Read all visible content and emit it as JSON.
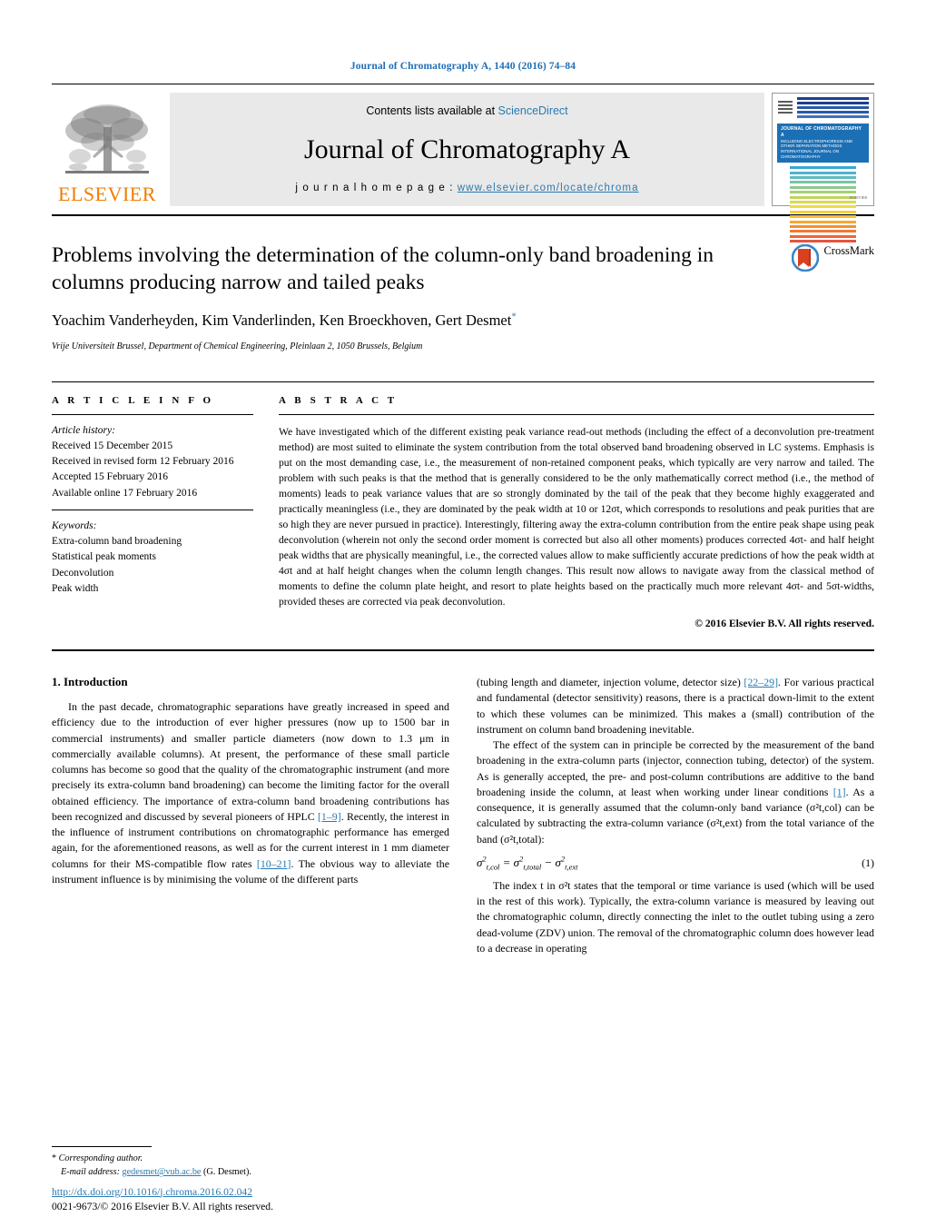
{
  "running_head": "Journal of Chromatography A, 1440 (2016) 74–84",
  "masthead": {
    "publisher_name": "ELSEVIER",
    "contents_prefix": "Contents lists available at ",
    "contents_link": "ScienceDirect",
    "journal_title": "Journal of Chromatography A",
    "homepage_prefix": "j o u r n a l   h o m e p a g e :   ",
    "homepage_url": "www.elsevier.com/locate/chroma",
    "cover": {
      "title": "JOURNAL OF CHROMATOGRAPHY A",
      "subtitle": "INCLUDING ELECTROPHORESIS AND OTHER SEPARATION METHODS INTERNATIONAL JOURNAL ON CHROMATOGRAPHY",
      "footer": "ELSEVIER"
    }
  },
  "article": {
    "title": "Problems involving the determination of the column-only band broadening in columns producing narrow and tailed peaks",
    "authors": "Yoachim Vanderheyden, Kim Vanderlinden, Ken Broeckhoven, Gert Desmet",
    "corresponding_marker": "*",
    "affiliation": "Vrije Universiteit Brussel, Department of Chemical Engineering, Pleinlaan 2, 1050 Brussels, Belgium",
    "crossmark_label": "CrossMark"
  },
  "info": {
    "heading": "A R T I C L E     I N F O",
    "history_label": "Article history:",
    "history": [
      "Received 15 December 2015",
      "Received in revised form 12 February 2016",
      "Accepted 15 February 2016",
      "Available online 17 February 2016"
    ],
    "keywords_label": "Keywords:",
    "keywords": [
      "Extra-column band broadening",
      "Statistical peak moments",
      "Deconvolution",
      "Peak width"
    ]
  },
  "abstract": {
    "heading": "A B S T R A C T",
    "text": "We have investigated which of the different existing peak variance read-out methods (including the effect of a deconvolution pre-treatment method) are most suited to eliminate the system contribution from the total observed band broadening observed in LC systems. Emphasis is put on the most demanding case, i.e., the measurement of non-retained component peaks, which typically are very narrow and tailed. The problem with such peaks is that the method that is generally considered to be the only mathematically correct method (i.e., the method of moments) leads to peak variance values that are so strongly dominated by the tail of the peak that they become highly exaggerated and practically meaningless (i.e., they are dominated by the peak width at 10 or 12σt, which corresponds to resolutions and peak purities that are so high they are never pursued in practice). Interestingly, filtering away the extra-column contribution from the entire peak shape using peak deconvolution (wherein not only the second order moment is corrected but also all other moments) produces corrected 4σt- and half height peak widths that are physically meaningful, i.e., the corrected values allow to make sufficiently accurate predictions of how the peak width at 4σt and at half height changes when the column length changes. This result now allows to navigate away from the classical method of moments to define the column plate height, and resort to plate heights based on the practically much more relevant 4σt- and 5σt-widths, provided theses are corrected via peak deconvolution.",
    "copyright": "© 2016 Elsevier B.V. All rights reserved."
  },
  "body": {
    "section_number": "1.",
    "section_title": "Introduction",
    "left_para_1_a": "In the past decade, chromatographic separations have greatly increased in speed and efficiency due to the introduction of ever higher pressures (now up to 1500 bar in commercial instruments) and smaller particle diameters (now down to 1.3 μm in commercially available columns). At present, the performance of these small particle columns has become so good that the quality of the chromatographic instrument (and more precisely its extra-column band broadening) can become the limiting factor for the overall obtained efficiency. The importance of extra-column band broadening contributions has been recognized and discussed by several pioneers of HPLC ",
    "left_ref_1": "[1–9]",
    "left_para_1_b": ". Recently, the interest in the influence of instrument contributions on chromatographic performance has emerged again, for the aforementioned reasons, as well as for the current interest in 1 mm diameter columns for their MS-compatible flow rates ",
    "left_ref_2": "[10–21]",
    "left_para_1_c": ". The obvious way to alleviate the instrument influence is by minimising the volume of the different parts",
    "right_para_1_a": "(tubing length and diameter, injection volume, detector size) ",
    "right_ref_1": "[22–29]",
    "right_para_1_b": ". For various practical and fundamental (detector sensitivity) reasons, there is a practical down-limit to the extent to which these volumes can be minimized. This makes a (small) contribution of the instrument on column band broadening inevitable.",
    "right_para_2_a": "The effect of the system can in principle be corrected by the measurement of the band broadening in the extra-column parts (injector, connection tubing, detector) of the system. As is generally accepted, the pre- and post-column contributions are additive to the band broadening inside the column, at least when working under linear conditions ",
    "right_ref_2": "[1]",
    "right_para_2_b": ". As a consequence, it is generally assumed that the column-only band variance (σ²t,col) can be calculated by subtracting the extra-column variance (σ²t,ext) from the total variance of the band (σ²t,total):",
    "equation_number": "(1)",
    "right_para_3": "The index t in σ²t states that the temporal or time variance is used (which will be used in the rest of this work). Typically, the extra-column variance is measured by leaving out the chromatographic column, directly connecting the inlet to the outlet tubing using a zero dead-volume (ZDV) union. The removal of the chromatographic column does however lead to a decrease in operating"
  },
  "footnote": {
    "marker": "*",
    "corresponding": "Corresponding author.",
    "email_label": "E-mail address:",
    "email": "gedesmet@vub.ac.be",
    "email_suffix": "(G. Desmet)."
  },
  "footer": {
    "doi": "http://dx.doi.org/10.1016/j.chroma.2016.02.042",
    "issn": "0021-9673/© 2016 Elsevier B.V. All rights reserved."
  },
  "colors": {
    "link_blue": "#2a7ab0",
    "running_head_blue": "#1f6eb5",
    "elsevier_orange": "#f07d00"
  }
}
